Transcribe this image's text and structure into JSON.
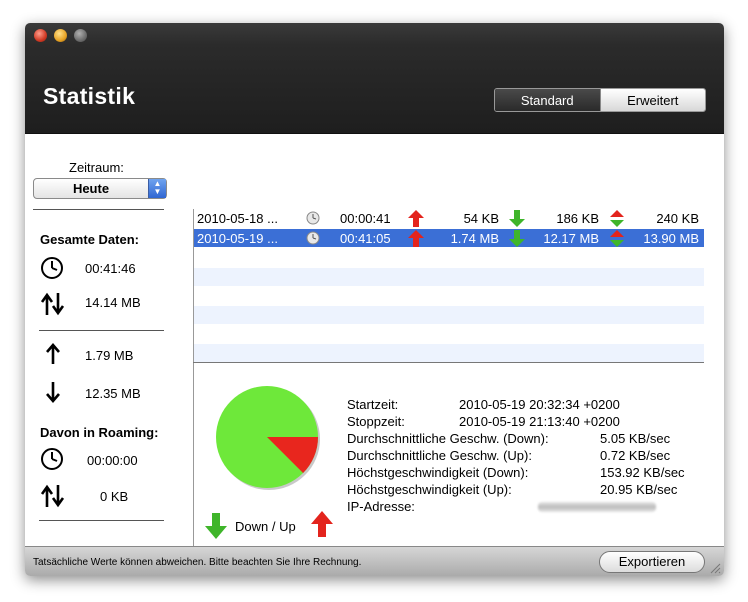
{
  "window": {
    "title": "Statistik"
  },
  "view_toggle": {
    "standard": "Standard",
    "erweitert": "Erweitert",
    "selected": "Standard"
  },
  "filter": {
    "label": "Zeitraum:",
    "value": "Heute"
  },
  "sidebar": {
    "total_heading": "Gesamte Daten:",
    "total_time": "00:41:46",
    "total_volume": "14.14 MB",
    "upload": "1.79 MB",
    "download": "12.35 MB",
    "roaming_heading": "Davon in Roaming:",
    "roaming_time": "00:00:00",
    "roaming_volume": "0 KB"
  },
  "sessions": [
    {
      "start": "2010-05-18 ...",
      "duration": "00:00:41",
      "up": "54 KB",
      "down": "186 KB",
      "total": "240 KB",
      "selected": false
    },
    {
      "start": "2010-05-19 ...",
      "duration": "00:41:05",
      "up": "1.74 MB",
      "down": "12.17 MB",
      "total": "13.90 MB",
      "selected": true
    }
  ],
  "details": {
    "startzeit_label": "Startzeit:",
    "startzeit": "2010-05-19 20:32:34 +0200",
    "stoppzeit_label": "Stoppzeit:",
    "stoppzeit": "2010-05-19 21:13:40 +0200",
    "avg_down_label": "Durchschnittliche Geschw. (Down):",
    "avg_down": "5.05 KB/sec",
    "avg_up_label": "Durchschnittliche Geschw. (Up):",
    "avg_up": "0.72 KB/sec",
    "max_down_label": "Höchstgeschwindigkeit (Down):",
    "max_down": "153.92 KB/sec",
    "max_up_label": "Höchstgeschwindigkeit (Up):",
    "max_up": "20.95 KB/sec",
    "ip_label": "IP-Adresse:"
  },
  "pie": {
    "down_fraction": 0.875,
    "up_fraction": 0.125,
    "down_color": "#6ee83a",
    "up_color": "#e8261e",
    "legend": "Down / Up"
  },
  "footer": {
    "note": "Tatsächliche Werte können abweichen. Bitte beachten Sie Ihre Rechnung.",
    "export": "Exportieren"
  },
  "icons": {
    "clock": "clock-icon",
    "updown": "up-down-arrows-icon",
    "up": "up-arrow-icon",
    "down": "down-arrow-icon"
  }
}
